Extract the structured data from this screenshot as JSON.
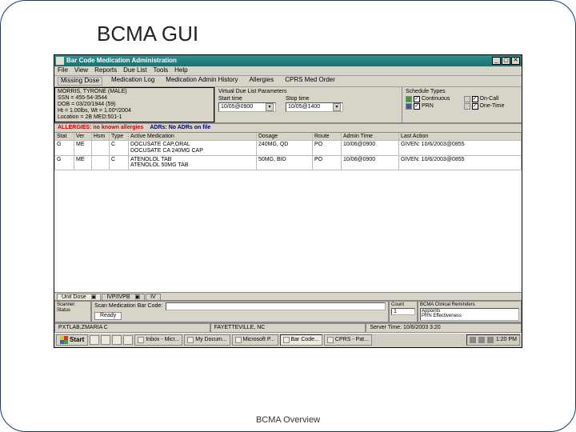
{
  "slide": {
    "title": "BCMA GUI",
    "footer": "BCMA Overview"
  },
  "window": {
    "title": "Bar Code Medication Administration",
    "min": "_",
    "max": "▢",
    "close": "✕"
  },
  "menu": [
    "File",
    "View",
    "Reports",
    "Due List",
    "Tools",
    "Help"
  ],
  "toolbar": {
    "missing_dose": "Missing Dose",
    "med_log": "Medication Log",
    "med_admin_hist": "Medication Admin History",
    "allergies": "Allergies",
    "cprs_order": "CPRS Med Order"
  },
  "patient": {
    "name": "MORRIS, TYRONE (MALE)",
    "ssn": "SSN = 455-54-3544",
    "dob": "DOB = 03/20/1944 (59)",
    "ht_wt": "Ht = 1.00lbs, Wt = 1.00*/2004",
    "location": "Location = 2B MED:501-1"
  },
  "vdl": {
    "title": "Virtual Due List Parameters",
    "start_label": "Start time",
    "start_value": "10/05@0900",
    "stop_label": "Stop time",
    "stop_value": "10/05@1400"
  },
  "sched": {
    "title": "Schedule Types",
    "continuous": "Continuous",
    "oncall": "On-Call",
    "prn": "PRN",
    "onetime": "One-Time"
  },
  "alerts": {
    "allergies": "ALLERGIES: no known allergies",
    "adrs": "ADRs: No ADRs on file"
  },
  "grid": {
    "headers": {
      "stat": "Stat",
      "ver": "Ver",
      "hsm": "Hsm",
      "type": "Type",
      "med": "Active Medication",
      "dose": "Dosage",
      "route": "Route",
      "admin": "Admin Time",
      "last": "Last Action"
    },
    "rows": [
      {
        "stat": "G",
        "ver": "ME",
        "hsm": "",
        "type": "C",
        "med": "DOCUSATE CAP,ORAL\n  DOCUSATE CA 240MG CAP",
        "dose": "240MG, QD",
        "route": "PO",
        "admin": "10/06@0900",
        "last": "GIVEN: 10/6/2003@0855"
      },
      {
        "stat": "G",
        "ver": "ME",
        "hsm": "",
        "type": "C",
        "med": "ATENOLOL TAB\n  ATENOLOL 50MG TAB",
        "dose": "50MG, BID",
        "route": "PO",
        "admin": "10/06@0900",
        "last": "GIVEN: 10/6/2003@0855"
      }
    ]
  },
  "tabs": {
    "unit_dose": "Unit Dose",
    "ivp_ivpb": "IVP/IVPB",
    "iv": "IV"
  },
  "scanner": {
    "label": "Scanner Status",
    "scan_label": "Scan Medication Bar Code:",
    "ready": "Ready"
  },
  "count": {
    "label": "Count",
    "value": "1"
  },
  "reminders": {
    "title": "BCMA Clinical Reminders",
    "items": [
      "Appoints",
      "PRN Effectiveness"
    ]
  },
  "statusbar": {
    "user": "PXTLAB,ZMARIA C",
    "division": "FAYETTEVILLE, NC",
    "server": "Server Time: 10/6/2003   3:20"
  },
  "taskbar": {
    "start": "Start",
    "items": [
      {
        "label": "Inbox - Micr..."
      },
      {
        "label": "My Docum..."
      },
      {
        "label": "Microsoft P..."
      },
      {
        "label": "Bar Code...",
        "active": true
      },
      {
        "label": "CPRS - Pat..."
      }
    ],
    "clock": "1:20 PM"
  }
}
